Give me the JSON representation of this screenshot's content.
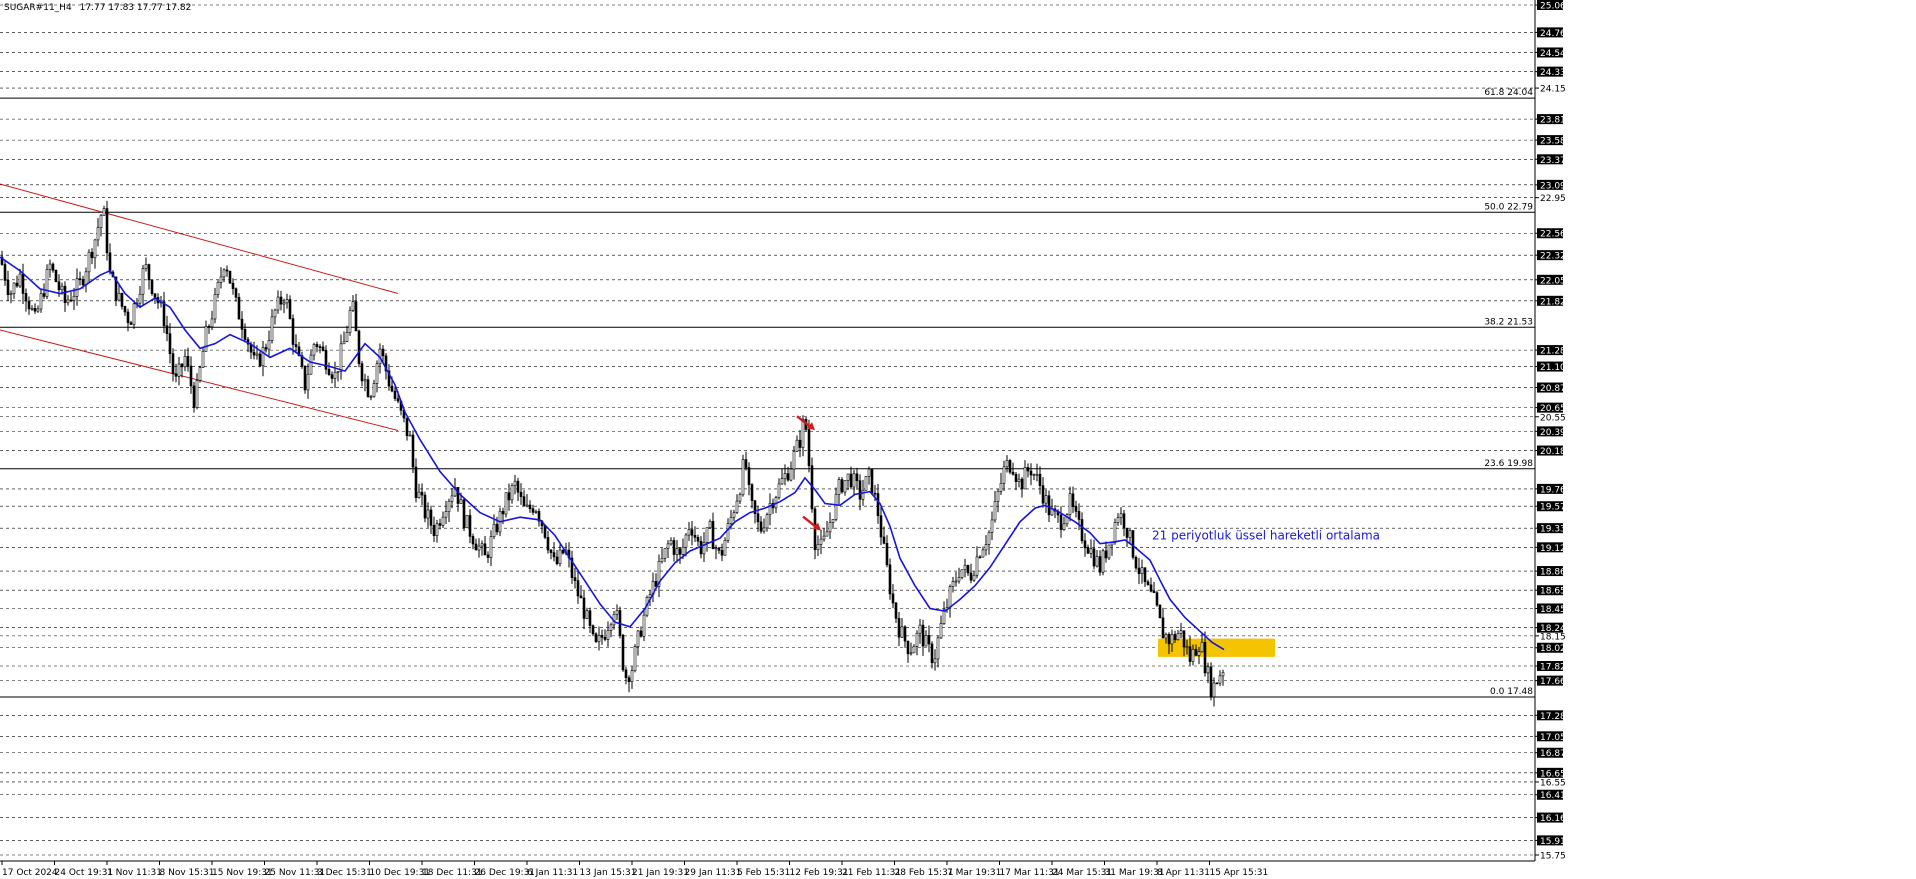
{
  "header": {
    "symbol": "SUGAR#11_H4",
    "ohlc": "17.77 17.83 17.77 17.82"
  },
  "chart_data": {
    "type": "candlestick",
    "symbol": "SUGAR#11_H4",
    "timeframe": "H4",
    "last_ohlc": {
      "open": 17.77,
      "high": 17.83,
      "low": 17.77,
      "close": 17.82
    },
    "ylim": [
      15.75,
      25.06
    ],
    "price_axis_labels": [
      "25.06",
      "24.76",
      "24.54",
      "24.33",
      "24.15",
      "23.81",
      "23.58",
      "23.37",
      "23.09",
      "22.95",
      "22.56",
      "22.32",
      "22.05",
      "21.82",
      "21.28",
      "21.10",
      "20.87",
      "20.65",
      "20.55",
      "20.39",
      "20.18",
      "19.76",
      "19.57",
      "19.33",
      "19.12",
      "18.86",
      "18.65",
      "18.45",
      "18.24",
      "18.15",
      "18.02",
      "17.82",
      "17.66",
      "17.28",
      "17.05",
      "16.87",
      "16.65",
      "16.55",
      "16.41",
      "16.16",
      "15.91",
      "15.75"
    ],
    "highlighted_price_labels": [
      "25.06",
      "24.76",
      "24.54",
      "24.33",
      "23.81",
      "23.58",
      "23.37",
      "23.09",
      "22.56",
      "22.32",
      "22.05",
      "21.82",
      "21.28",
      "21.10",
      "20.87",
      "20.65",
      "20.39",
      "20.18",
      "19.76",
      "19.57",
      "19.33",
      "19.12",
      "18.86",
      "18.65",
      "18.45",
      "18.24",
      "18.02",
      "17.82",
      "17.66",
      "17.28",
      "17.05",
      "16.87",
      "16.65",
      "16.41",
      "16.16",
      "15.91"
    ],
    "time_axis_labels": [
      "17 Oct 2024",
      "24 Oct 19:31",
      "1 Nov 11:31",
      "8 Nov 15:31",
      "15 Nov 19:31",
      "25 Nov 11:31",
      "3 Dec 15:31",
      "10 Dec 19:31",
      "18 Dec 11:31",
      "26 Dec 19:31",
      "6 Jan 11:31",
      "13 Jan 15:31",
      "21 Jan 19:31",
      "29 Jan 11:31",
      "5 Feb 15:31",
      "12 Feb 19:31",
      "21 Feb 11:31",
      "28 Feb 15:31",
      "7 Mar 19:31",
      "17 Mar 11:31",
      "24 Mar 15:31",
      "31 Mar 19:31",
      "8 Apr 11:31",
      "15 Apr 15:31"
    ],
    "fibonacci_levels": [
      {
        "label": "61.8 24.04",
        "price": 24.04
      },
      {
        "label": "50.0 22.79",
        "price": 22.79
      },
      {
        "label": "38.2 21.53",
        "price": 21.53
      },
      {
        "label": "23.6 19.98",
        "price": 19.98
      },
      {
        "label": "0.0 17.48",
        "price": 17.48
      }
    ],
    "price_path": [
      [
        0,
        22.3
      ],
      [
        10,
        21.9
      ],
      [
        20,
        22.1
      ],
      [
        35,
        21.6
      ],
      [
        50,
        22.2
      ],
      [
        65,
        21.8
      ],
      [
        80,
        22.0
      ],
      [
        95,
        22.5
      ],
      [
        103,
        22.85
      ],
      [
        110,
        22.1
      ],
      [
        120,
        21.8
      ],
      [
        130,
        21.6
      ],
      [
        145,
        22.2
      ],
      [
        155,
        21.9
      ],
      [
        165,
        21.6
      ],
      [
        175,
        20.9
      ],
      [
        185,
        21.2
      ],
      [
        195,
        20.7
      ],
      [
        205,
        21.4
      ],
      [
        215,
        21.8
      ],
      [
        225,
        22.3
      ],
      [
        235,
        21.8
      ],
      [
        245,
        21.5
      ],
      [
        255,
        21.1
      ],
      [
        265,
        21.3
      ],
      [
        275,
        21.7
      ],
      [
        285,
        21.9
      ],
      [
        295,
        21.3
      ],
      [
        305,
        20.9
      ],
      [
        315,
        21.4
      ],
      [
        325,
        21.2
      ],
      [
        335,
        21.0
      ],
      [
        345,
        21.4
      ],
      [
        352,
        21.8
      ],
      [
        360,
        21.1
      ],
      [
        370,
        20.8
      ],
      [
        380,
        21.3
      ],
      [
        390,
        20.9
      ],
      [
        400,
        20.6
      ],
      [
        410,
        20.3
      ],
      [
        415,
        19.8
      ],
      [
        425,
        19.5
      ],
      [
        435,
        19.3
      ],
      [
        445,
        19.6
      ],
      [
        455,
        19.8
      ],
      [
        465,
        19.4
      ],
      [
        475,
        19.2
      ],
      [
        485,
        19.0
      ],
      [
        495,
        19.3
      ],
      [
        505,
        19.6
      ],
      [
        515,
        19.8
      ],
      [
        525,
        19.5
      ],
      [
        535,
        19.6
      ],
      [
        545,
        19.3
      ],
      [
        555,
        18.9
      ],
      [
        565,
        19.1
      ],
      [
        575,
        18.7
      ],
      [
        585,
        18.4
      ],
      [
        595,
        18.0
      ],
      [
        605,
        18.2
      ],
      [
        615,
        18.5
      ],
      [
        620,
        18.1
      ],
      [
        625,
        17.7
      ],
      [
        632,
        17.8
      ],
      [
        640,
        18.2
      ],
      [
        650,
        18.6
      ],
      [
        660,
        18.9
      ],
      [
        670,
        19.2
      ],
      [
        680,
        19.0
      ],
      [
        690,
        19.4
      ],
      [
        700,
        19.1
      ],
      [
        710,
        19.3
      ],
      [
        720,
        19.0
      ],
      [
        730,
        19.4
      ],
      [
        740,
        19.8
      ],
      [
        745,
        20.1
      ],
      [
        750,
        19.6
      ],
      [
        760,
        19.3
      ],
      [
        770,
        19.6
      ],
      [
        780,
        19.8
      ],
      [
        790,
        20.0
      ],
      [
        800,
        20.3
      ],
      [
        805,
        20.55
      ],
      [
        810,
        19.9
      ],
      [
        815,
        19.2
      ],
      [
        822,
        19.1
      ],
      [
        830,
        19.4
      ],
      [
        840,
        19.8
      ],
      [
        850,
        19.9
      ],
      [
        860,
        19.7
      ],
      [
        870,
        19.9
      ],
      [
        878,
        19.5
      ],
      [
        885,
        19.0
      ],
      [
        893,
        18.5
      ],
      [
        900,
        18.2
      ],
      [
        910,
        18.0
      ],
      [
        920,
        18.2
      ],
      [
        928,
        18.0
      ],
      [
        934,
        17.9
      ],
      [
        942,
        18.3
      ],
      [
        950,
        18.6
      ],
      [
        960,
        18.9
      ],
      [
        970,
        18.8
      ],
      [
        980,
        19.1
      ],
      [
        990,
        19.3
      ],
      [
        998,
        19.7
      ],
      [
        1005,
        20.0
      ],
      [
        1012,
        20.05
      ],
      [
        1020,
        19.8
      ],
      [
        1030,
        20.0
      ],
      [
        1040,
        19.8
      ],
      [
        1050,
        19.5
      ],
      [
        1060,
        19.4
      ],
      [
        1070,
        19.6
      ],
      [
        1080,
        19.3
      ],
      [
        1090,
        19.1
      ],
      [
        1100,
        18.9
      ],
      [
        1110,
        19.2
      ],
      [
        1118,
        19.5
      ],
      [
        1125,
        19.4
      ],
      [
        1135,
        19.0
      ],
      [
        1145,
        18.7
      ],
      [
        1155,
        18.5
      ],
      [
        1162,
        18.2
      ],
      [
        1170,
        18.1
      ],
      [
        1180,
        18.2
      ],
      [
        1190,
        17.9
      ],
      [
        1200,
        18.1
      ],
      [
        1206,
        17.8
      ],
      [
        1212,
        17.55
      ],
      [
        1218,
        17.7
      ],
      [
        1224,
        17.82
      ]
    ],
    "ema_path": [
      [
        0,
        22.3
      ],
      [
        20,
        22.15
      ],
      [
        40,
        21.95
      ],
      [
        60,
        21.9
      ],
      [
        80,
        21.95
      ],
      [
        100,
        22.1
      ],
      [
        110,
        22.15
      ],
      [
        125,
        21.9
      ],
      [
        140,
        21.75
      ],
      [
        155,
        21.85
      ],
      [
        170,
        21.75
      ],
      [
        185,
        21.5
      ],
      [
        200,
        21.3
      ],
      [
        215,
        21.35
      ],
      [
        230,
        21.45
      ],
      [
        250,
        21.35
      ],
      [
        270,
        21.2
      ],
      [
        290,
        21.3
      ],
      [
        310,
        21.15
      ],
      [
        330,
        21.1
      ],
      [
        345,
        21.05
      ],
      [
        355,
        21.2
      ],
      [
        365,
        21.35
      ],
      [
        380,
        21.2
      ],
      [
        395,
        20.9
      ],
      [
        405,
        20.6
      ],
      [
        420,
        20.3
      ],
      [
        440,
        19.95
      ],
      [
        460,
        19.7
      ],
      [
        480,
        19.5
      ],
      [
        500,
        19.4
      ],
      [
        520,
        19.45
      ],
      [
        540,
        19.42
      ],
      [
        555,
        19.25
      ],
      [
        570,
        19.0
      ],
      [
        585,
        18.75
      ],
      [
        600,
        18.5
      ],
      [
        615,
        18.3
      ],
      [
        630,
        18.25
      ],
      [
        645,
        18.45
      ],
      [
        660,
        18.75
      ],
      [
        675,
        18.95
      ],
      [
        690,
        19.08
      ],
      [
        705,
        19.15
      ],
      [
        720,
        19.22
      ],
      [
        735,
        19.4
      ],
      [
        750,
        19.5
      ],
      [
        765,
        19.55
      ],
      [
        780,
        19.62
      ],
      [
        795,
        19.72
      ],
      [
        805,
        19.88
      ],
      [
        815,
        19.75
      ],
      [
        825,
        19.6
      ],
      [
        840,
        19.58
      ],
      [
        855,
        19.7
      ],
      [
        870,
        19.73
      ],
      [
        880,
        19.6
      ],
      [
        890,
        19.35
      ],
      [
        900,
        19.0
      ],
      [
        915,
        18.7
      ],
      [
        930,
        18.45
      ],
      [
        945,
        18.42
      ],
      [
        960,
        18.55
      ],
      [
        975,
        18.7
      ],
      [
        990,
        18.9
      ],
      [
        1005,
        19.15
      ],
      [
        1020,
        19.4
      ],
      [
        1035,
        19.55
      ],
      [
        1045,
        19.58
      ],
      [
        1060,
        19.5
      ],
      [
        1075,
        19.4
      ],
      [
        1090,
        19.28
      ],
      [
        1100,
        19.16
      ],
      [
        1115,
        19.18
      ],
      [
        1125,
        19.2
      ],
      [
        1135,
        19.12
      ],
      [
        1150,
        18.98
      ],
      [
        1160,
        18.76
      ],
      [
        1170,
        18.55
      ],
      [
        1185,
        18.35
      ],
      [
        1200,
        18.2
      ],
      [
        1212,
        18.08
      ],
      [
        1224,
        18.0
      ]
    ],
    "channel_lines": [
      {
        "from": [
          0,
          23.1
        ],
        "to": [
          398,
          21.9
        ]
      },
      {
        "from": [
          0,
          21.5
        ],
        "to": [
          398,
          20.4
        ]
      }
    ],
    "highlight_zone": {
      "x_from": 1158,
      "x_to": 1275,
      "price_from": 17.92,
      "price_to": 18.12,
      "color": "#f5c400"
    },
    "arrows": [
      {
        "at": [
          806,
          20.48
        ],
        "color": "#d41b1b"
      },
      {
        "at": [
          812,
          19.38
        ],
        "color": "#d41b1b"
      }
    ],
    "annotations": [
      {
        "text": "21 periyotluk üssel hareketli ortalama",
        "at": [
          1152,
          19.25
        ]
      }
    ],
    "ema_color": "#1515e0",
    "channel_color": "#c81e1e",
    "grid": true
  }
}
